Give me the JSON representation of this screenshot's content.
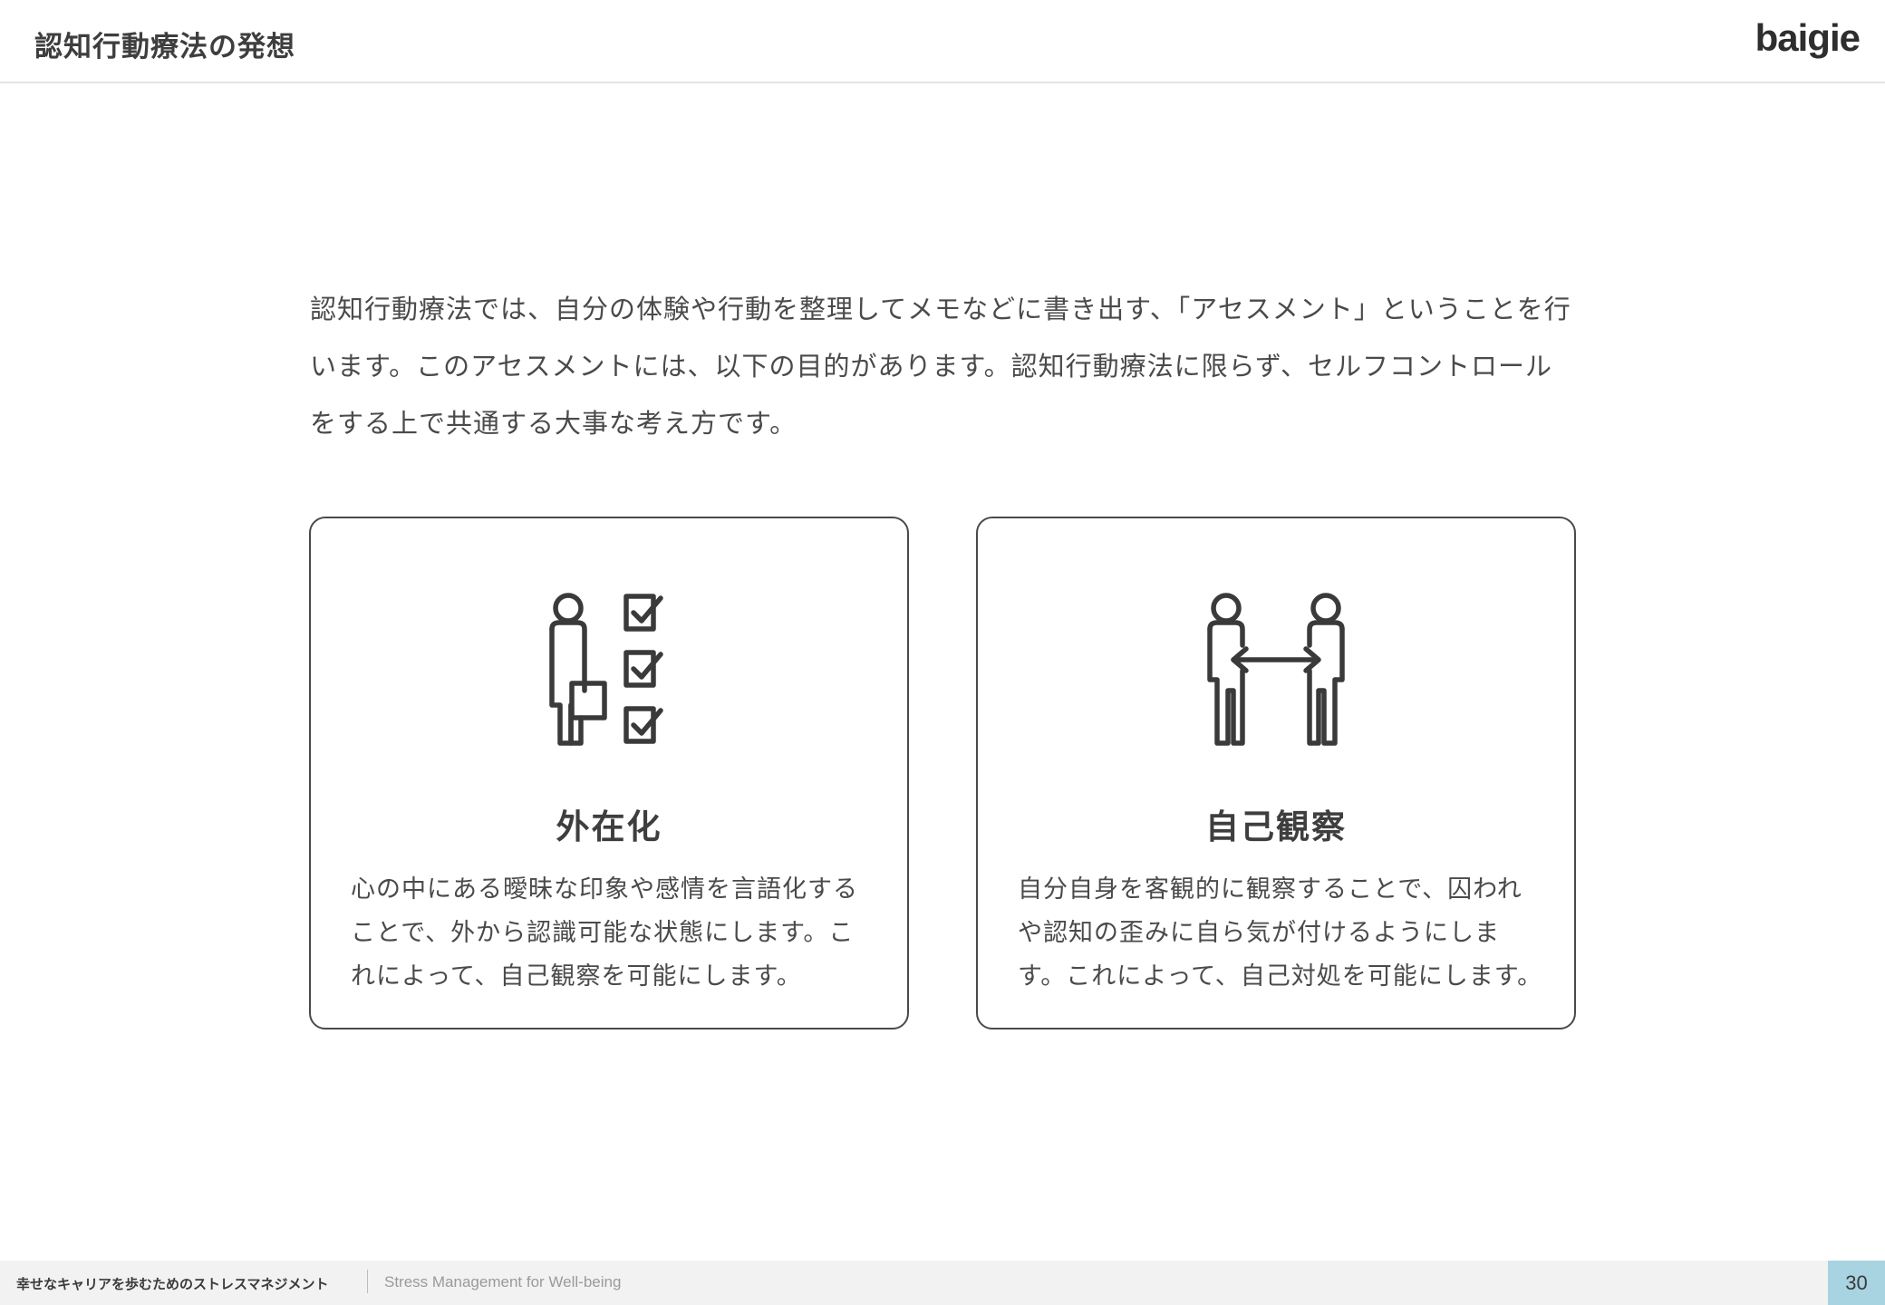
{
  "header": {
    "title": "認知行動療法の発想",
    "logo": "baigie"
  },
  "intro": {
    "text": "認知行動療法では、自分の体験や行動を整理してメモなどに書き出す、「アセスメント」ということを行います。このアセスメントには、以下の目的があります。認知行動療法に限らず、セルフコントロールをする上で共通する大事な考え方です。"
  },
  "cards": [
    {
      "icon": "person-checklist-icon",
      "title": "外在化",
      "body": "心の中にある曖昧な印象や感情を言語化することで、外から認識可能な状態にします。これによって、自己観察を可能にします。"
    },
    {
      "icon": "people-exchange-icon",
      "title": "自己観察",
      "body": "自分自身を客観的に観察することで、囚われや認知の歪みに自ら気が付けるようにします。これによって、自己対処を可能にします。"
    }
  ],
  "footer": {
    "title": "幸せなキャリアを歩むためのストレスマネジメント",
    "subtitle": "Stress Management for Well-being",
    "page_number": "30"
  },
  "colors": {
    "page_number_bg": "#a8d3e0",
    "footer_bg": "#f2f2f2",
    "text": "#3a3a3a",
    "border": "#4a4a4a"
  }
}
